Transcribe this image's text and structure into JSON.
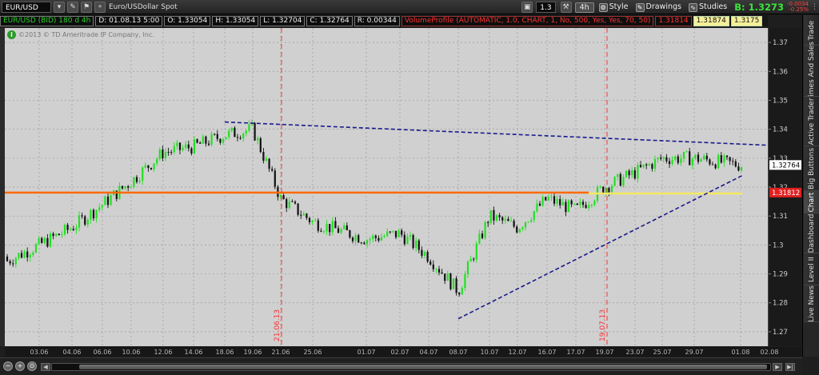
{
  "toolbar": {
    "symbol": "EUR/USD",
    "description": "Euro/USDollar Spot",
    "chart_number": "1.3",
    "period": "4h",
    "style_label": "Style",
    "drawings_label": "Drawings",
    "studies_label": "Studies",
    "last_price": "B: 1.3273",
    "net_change": "-0.0034",
    "net_change_pct": "-0.25%"
  },
  "infobar": {
    "series": "EUR/USD (BID) 180 d 4h",
    "date": "D: 01.08.13 5:00",
    "open": "O: 1.33054",
    "high": "H: 1.33054",
    "low": "L: 1.32704",
    "close": "C: 1.32764",
    "range": "R: 0.00344",
    "study": "VolumeProfile (AUTOMATIC, 1.0, CHART, 1, No, 500, Yes, Yes, 70, 50)",
    "vp1": "1.31814",
    "vp2": "1.31874",
    "vp3": "1.3175"
  },
  "copyright": "©2013 © TD Ameritrade IP Company, Inc.",
  "price_axis": {
    "ticks": [
      "1.37",
      "1.36",
      "1.35",
      "1.34",
      "1.33",
      "1.32",
      "1.31",
      "1.3",
      "1.29",
      "1.28",
      "1.27"
    ],
    "last_label": "1.32764",
    "profile_label": "1.31812"
  },
  "time_axis": {
    "ticks": [
      "03.06",
      "04.06",
      "06.06",
      "10.06",
      "12.06",
      "14.06",
      "18.06",
      "19.06",
      "21.06",
      "25.06",
      "01.07",
      "02.07",
      "04.07",
      "08.07",
      "10.07",
      "12.07",
      "16.07",
      "17.07",
      "19.07",
      "23.07",
      "25.07",
      "29.07",
      "01.08",
      "02.08"
    ]
  },
  "markers": [
    {
      "label": "21.06.13"
    },
    {
      "label": "19.07.13"
    }
  ],
  "sidetabs": [
    "Trade",
    "Times And Sales",
    "Active Trader",
    "Big Buttons",
    "Chart",
    "Dashboard",
    "Level II",
    "Live News"
  ],
  "colors": {
    "up": "#22e022",
    "down": "#111111",
    "trend": "#1a1a8c",
    "support": "#ff6a00",
    "profile": "#f4ea60",
    "marker": "#ff3030"
  },
  "chart_data": {
    "type": "candlestick",
    "ylim": [
      1.265,
      1.375
    ],
    "x": [
      "03.06",
      "04.06",
      "06.06",
      "10.06",
      "12.06",
      "14.06",
      "18.06",
      "19.06",
      "21.06",
      "25.06",
      "01.07",
      "02.07",
      "04.07",
      "08.07",
      "10.07",
      "12.07",
      "16.07",
      "17.07",
      "19.07",
      "23.07",
      "25.07",
      "29.07",
      "01.08"
    ],
    "close": [
      1.3,
      1.306,
      1.314,
      1.322,
      1.332,
      1.334,
      1.338,
      1.34,
      1.316,
      1.308,
      1.302,
      1.304,
      1.296,
      1.284,
      1.31,
      1.306,
      1.316,
      1.312,
      1.32,
      1.325,
      1.33,
      1.33,
      1.3276
    ],
    "trendlines": [
      {
        "name": "upper",
        "from": [
          "18.06",
          1.3425
        ],
        "to": [
          "02.08",
          1.3345
        ]
      },
      {
        "name": "lower",
        "from": [
          "08.07",
          1.2745
        ],
        "to": [
          "01.08",
          1.324
        ]
      }
    ],
    "hlines": [
      1.3181,
      1.3178
    ]
  }
}
